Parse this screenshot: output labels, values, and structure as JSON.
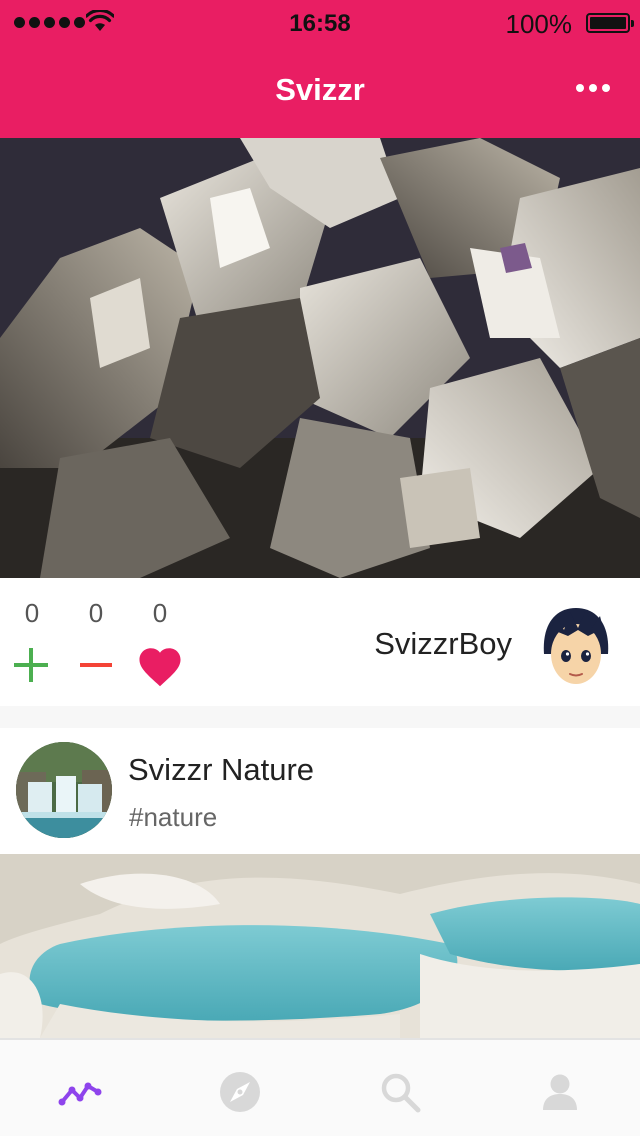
{
  "status_bar": {
    "time": "16:58",
    "battery_percent": "100%",
    "signal_bars": 5,
    "icons": [
      "signal-dots-icon",
      "wifi-icon",
      "battery-icon"
    ]
  },
  "header": {
    "title": "Svizzr",
    "menu_icon": "more-horizontal-icon"
  },
  "posts": [
    {
      "image": "pyrite-crystals-photo",
      "counts": {
        "plus": "0",
        "minus": "0",
        "likes": "0"
      },
      "author": "SvizzrBoy",
      "avatar": "anime-boy-avatar"
    },
    {
      "channel": "Svizzr Nature",
      "tag": "#nature",
      "avatar": "waterfall-avatar",
      "image": "travertine-pools-photo"
    }
  ],
  "tabbar": {
    "items": [
      {
        "icon": "activity-icon",
        "active": true
      },
      {
        "icon": "compass-icon",
        "active": false
      },
      {
        "icon": "search-icon",
        "active": false
      },
      {
        "icon": "profile-icon",
        "active": false
      }
    ]
  },
  "colors": {
    "brand": "#e91e63",
    "plus": "#4caf50",
    "minus": "#f44336",
    "heart": "#e91e63",
    "active_tab": "#8e44ec",
    "inactive_tab": "#d8d8d8"
  }
}
